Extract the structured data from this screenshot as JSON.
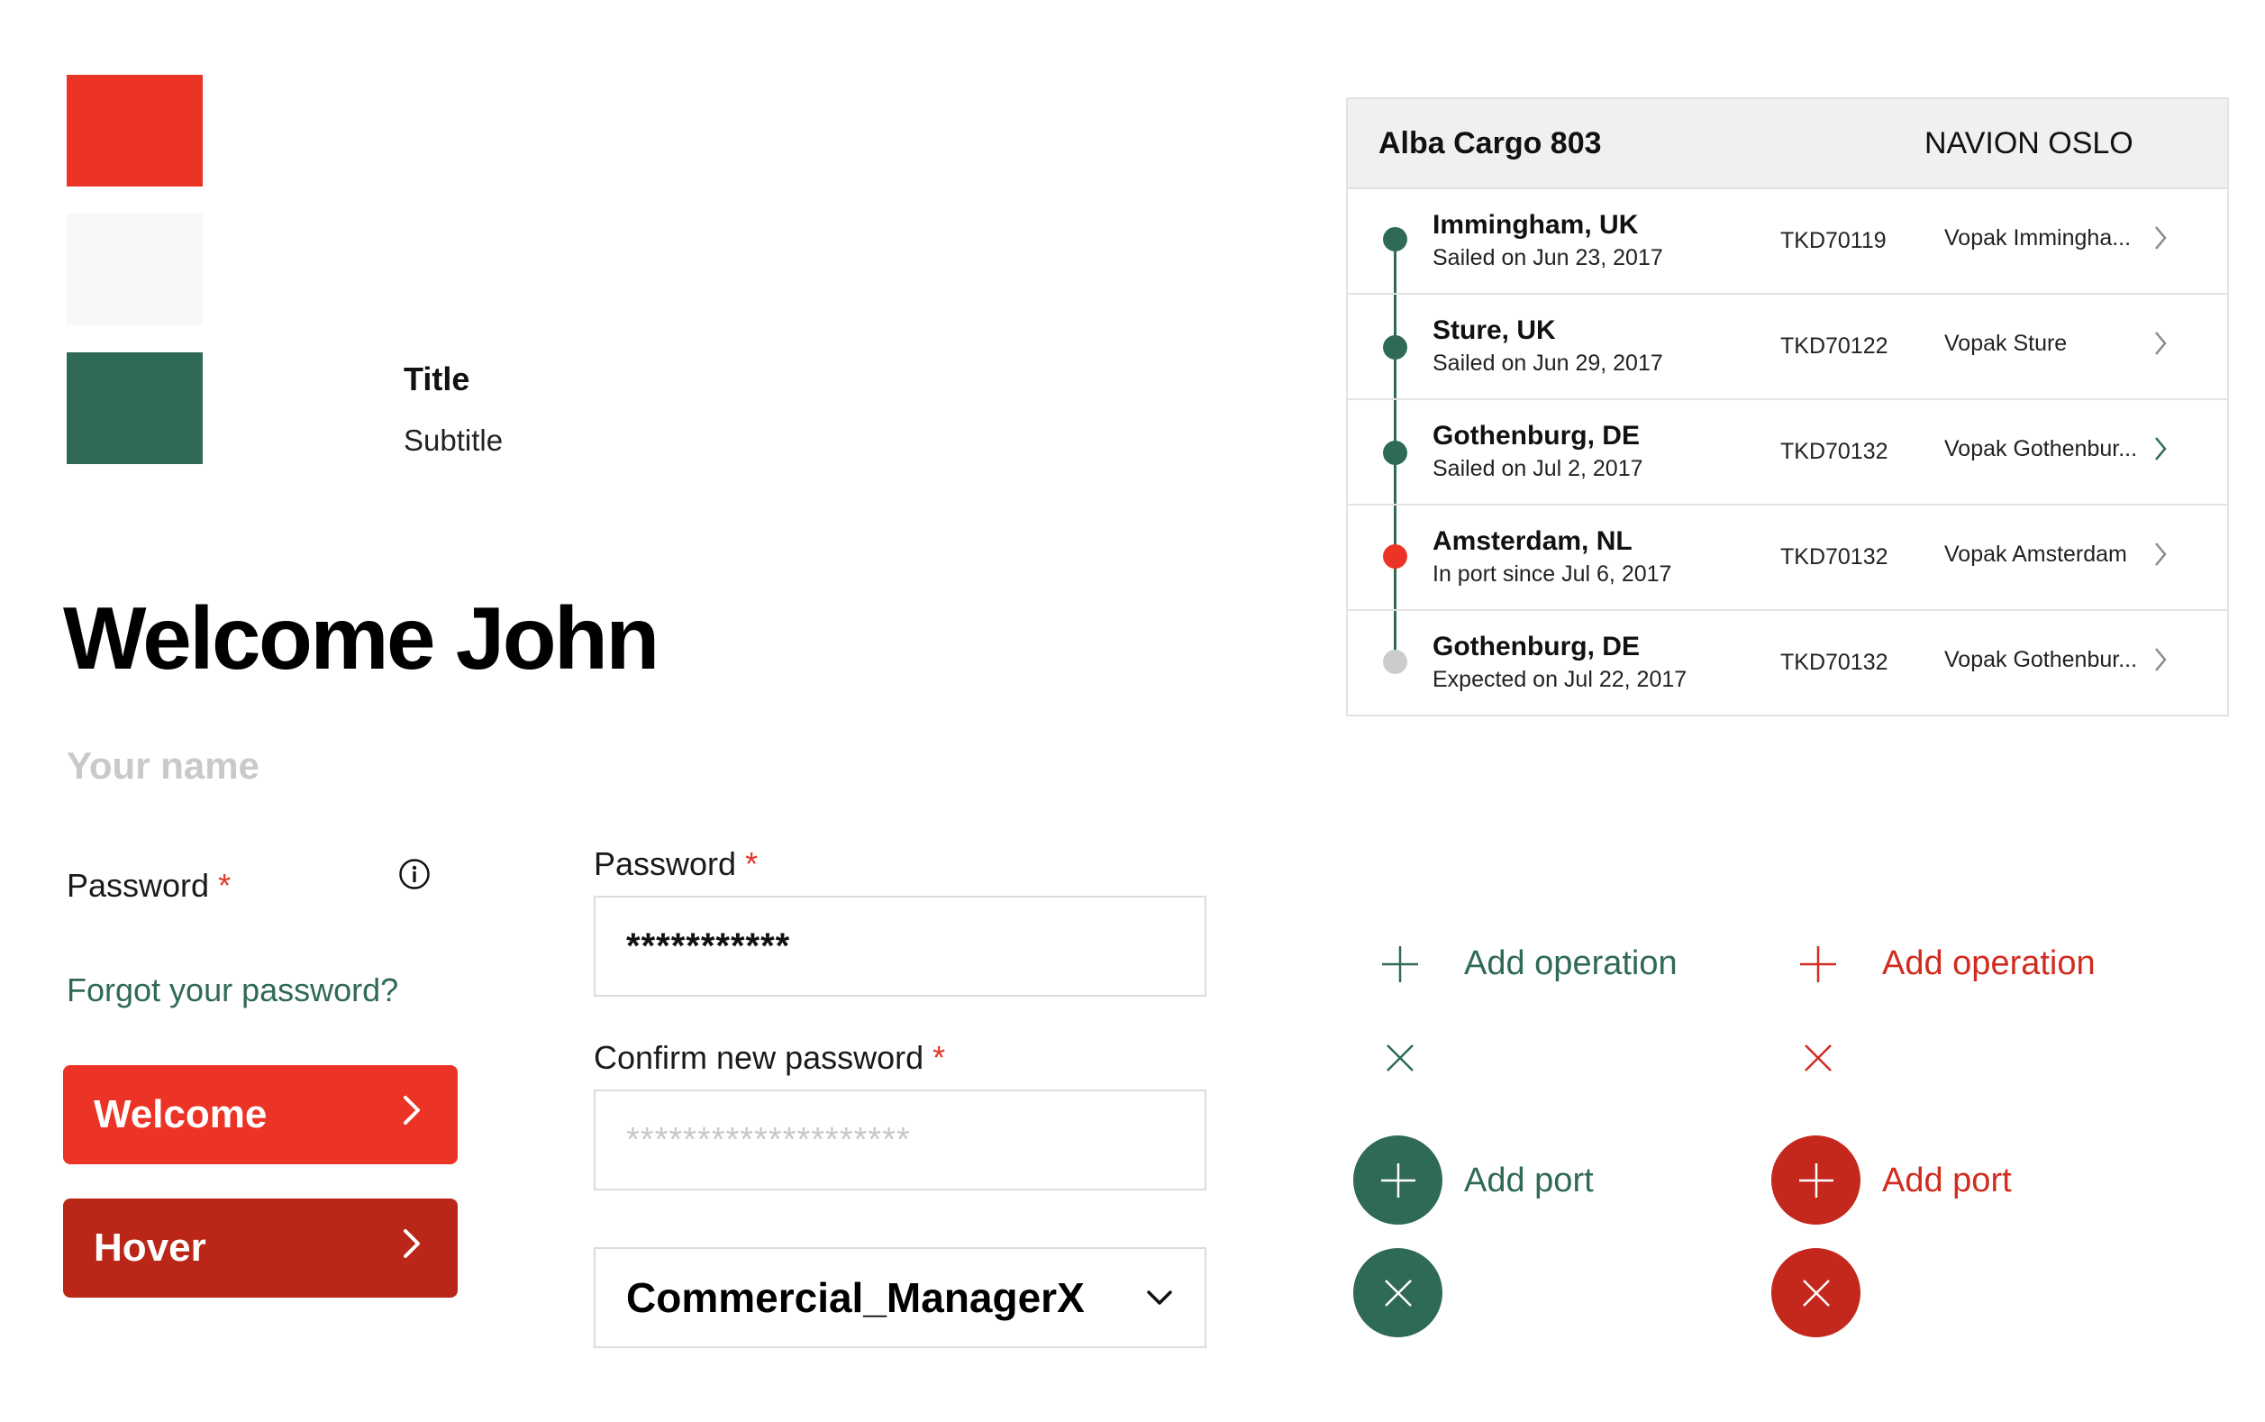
{
  "colors": {
    "red": "#ec3426",
    "red_dark": "#ba2719",
    "green": "#2f6a55",
    "light_grey": "#f8f8f8",
    "timeline_future": "#cccccc"
  },
  "swatches": [
    {
      "name": "red",
      "color": "#ec3426"
    },
    {
      "name": "light-grey",
      "color": "#f8f8f8"
    },
    {
      "name": "green",
      "color": "#2f6a55"
    }
  ],
  "card": {
    "title": "Title",
    "subtitle": "Subtitle"
  },
  "welcome": "Welcome John",
  "name_placeholder": "Your name",
  "password_label": "Password",
  "required_mark": "*",
  "info_icon": "info-icon",
  "forgot_link": "Forgot your password?",
  "buttons": {
    "primary": {
      "label": "Welcome",
      "icon": "chevron-right-icon"
    },
    "hover": {
      "label": "Hover",
      "icon": "chevron-right-icon"
    }
  },
  "form": {
    "password": {
      "label": "Password",
      "value": "***********"
    },
    "confirm": {
      "label": "Confirm new password",
      "placeholder": "********************"
    },
    "role_select": {
      "value": "Commercial_ManagerX",
      "icon": "chevron-down-icon"
    }
  },
  "voyage": {
    "vessel": "Alba Cargo 803",
    "flag": "NAVION OSLO",
    "stops": [
      {
        "port": "Immingham, UK",
        "status": "Sailed on Jun 23, 2017",
        "ref": "TKD70119",
        "terminal": "Vopak Immingha...",
        "state": "done"
      },
      {
        "port": "Sture, UK",
        "status": "Sailed on Jun 29, 2017",
        "ref": "TKD70122",
        "terminal": "Vopak Sture",
        "state": "done"
      },
      {
        "port": "Gothenburg, DE",
        "status": "Sailed on Jul 2, 2017",
        "ref": "TKD70132",
        "terminal": "Vopak Gothenbur...",
        "state": "done"
      },
      {
        "port": "Amsterdam, NL",
        "status": "In port since Jul 6, 2017",
        "ref": "TKD70132",
        "terminal": "Vopak Amsterdam",
        "state": "current"
      },
      {
        "port": "Gothenburg, DE",
        "status": "Expected on Jul 22, 2017",
        "ref": "TKD70132",
        "terminal": "Vopak Gothenbur...",
        "state": "future"
      }
    ]
  },
  "actions": {
    "green": {
      "add_operation": "Add operation",
      "add_port": "Add port"
    },
    "red": {
      "add_operation": "Add operation",
      "add_port": "Add port"
    }
  }
}
